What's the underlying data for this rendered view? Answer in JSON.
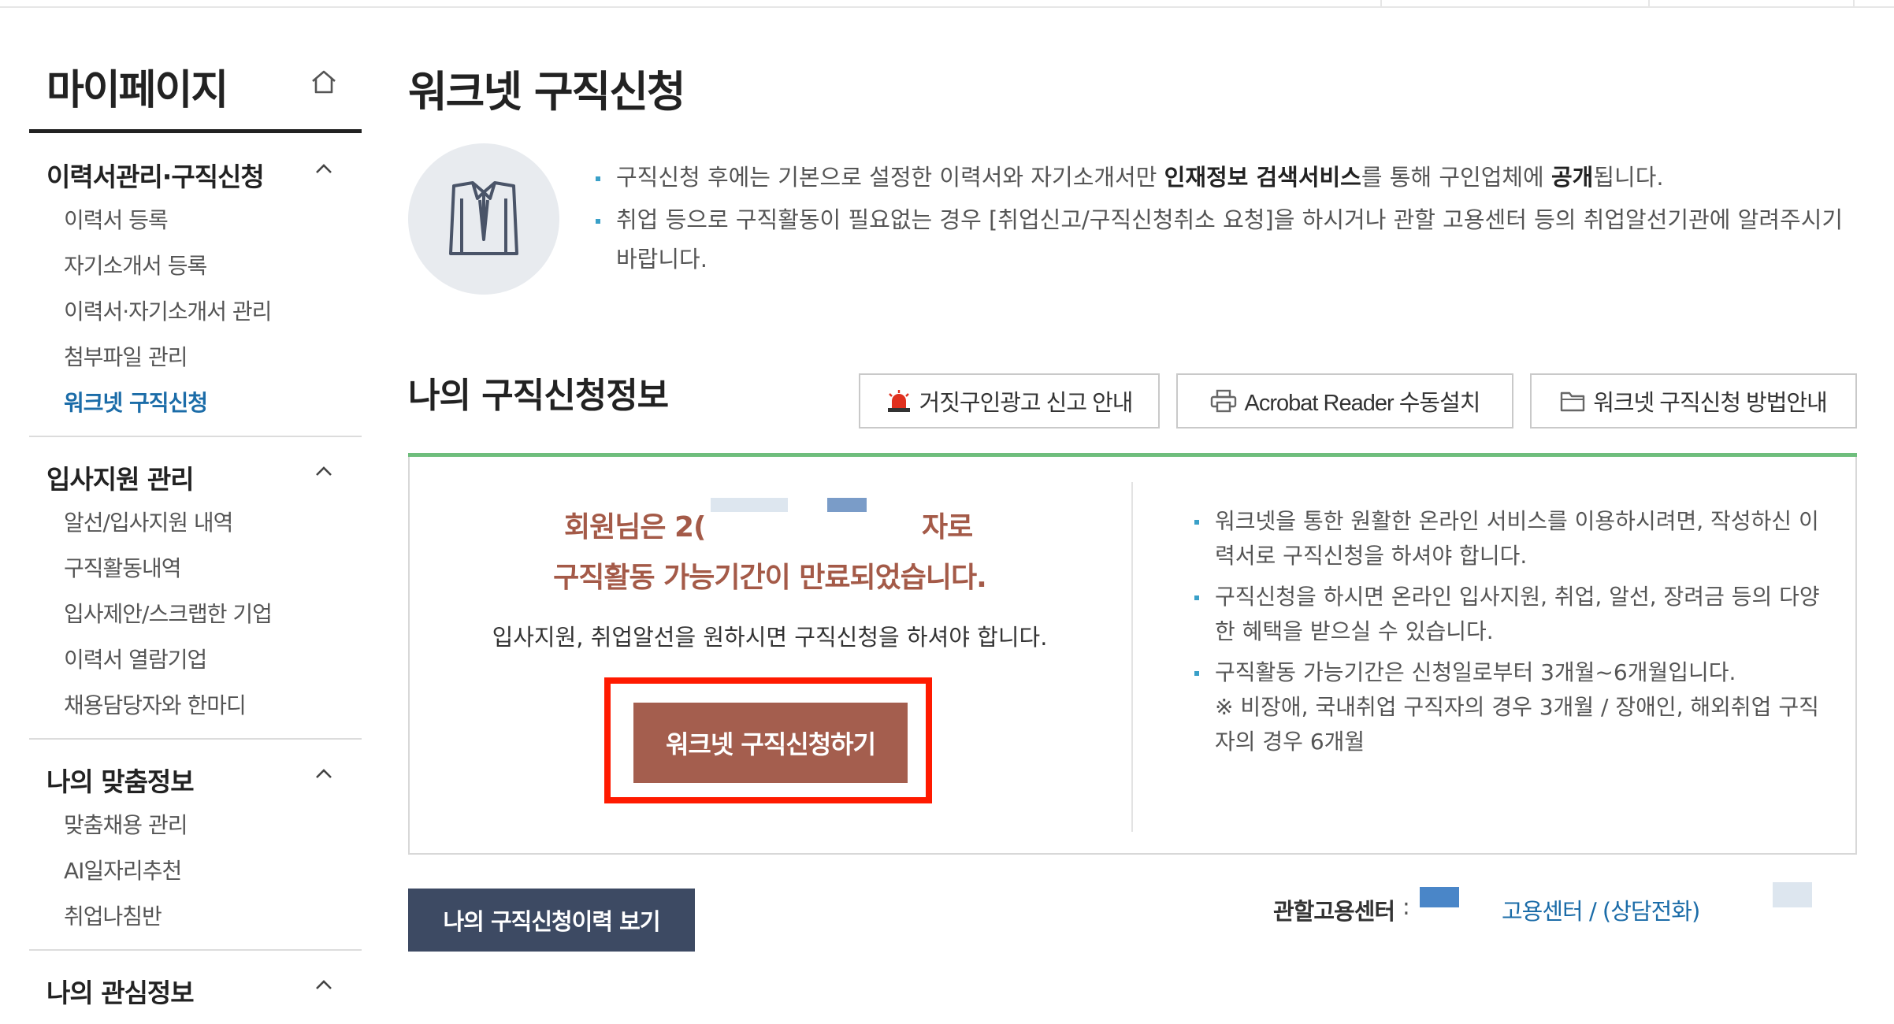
{
  "sidebar": {
    "title": "마이페이지",
    "groups": [
      {
        "title": "이력서관리·구직신청",
        "items": [
          "이력서 등록",
          "자기소개서 등록",
          "이력서·자기소개서 관리",
          "첨부파일 관리",
          "워크넷 구직신청"
        ],
        "active_item": "워크넷 구직신청"
      },
      {
        "title": "입사지원 관리",
        "items": [
          "알선/입사지원 내역",
          "구직활동내역",
          "입사제안/스크랩한 기업",
          "이력서 열람기업",
          "채용담당자와 한마디"
        ]
      },
      {
        "title": "나의 맞춤정보",
        "items": [
          "맞춤채용 관리",
          "AI일자리추천",
          "취업나침반"
        ]
      },
      {
        "title": "나의 관심정보",
        "items": []
      }
    ]
  },
  "main": {
    "title": "워크넷 구직신청",
    "notice": {
      "line1_pre": "구직신청 후에는 기본으로 설정한 이력서와 자기소개서만 ",
      "line1_bold1": "인재정보 검색서비스",
      "line1_mid": "를 통해 구인업체에 ",
      "line1_bold2": "공개",
      "line1_post": "됩니다.",
      "line2": "취업 등으로 구직활동이 필요없는 경우 [취업신고/구직신청취소 요청]을 하시거나 관할 고용센터 등의 취업알선기관에 알려주시기 바랍니다."
    },
    "section_title": "나의 구직신청정보",
    "top_buttons": [
      {
        "label": "거짓구인광고 신고 안내",
        "icon": "siren-icon"
      },
      {
        "label": "Acrobat Reader 수동설치",
        "icon": "printer-icon"
      },
      {
        "label": "워크넷 구직신청 방법안내",
        "icon": "folder-icon"
      }
    ],
    "status": {
      "line1_left": "회원님은 2(",
      "line1_right": "자로",
      "line2": "구직활동 가능기간이 만료되었습니다.",
      "sub": "입사지원, 취업알선을 원하시면 구직신청을 하셔야 합니다.",
      "apply_button": "워크넷 구직신청하기"
    },
    "info": [
      "워크넷을 통한 원활한 온라인 서비스를 이용하시려면, 작성하신 이력서로 구직신청을 하셔야 합니다.",
      "구직신청을 하시면 온라인 입사지원, 취업, 알선, 장려금 등의 다양한 혜택을 받으실 수 있습니다.",
      "구직활동 가능기간은 신청일로부터 3개월~6개월입니다.\n※ 비장애, 국내취업 구직자의 경우 3개월 / 장애인, 해외취업 구직자의 경우 6개월"
    ],
    "history_button": "나의 구직신청이력 보기",
    "center": {
      "label": "관할고용센터",
      "colon": ":",
      "link": "고용센터 / (상담전화)"
    }
  },
  "colors": {
    "accent_green": "#6fbe7d",
    "alert_brown": "#a45a48",
    "highlight_red": "#ff1a00",
    "link_blue": "#1b6ca8",
    "dark_navy": "#3d4a63"
  }
}
